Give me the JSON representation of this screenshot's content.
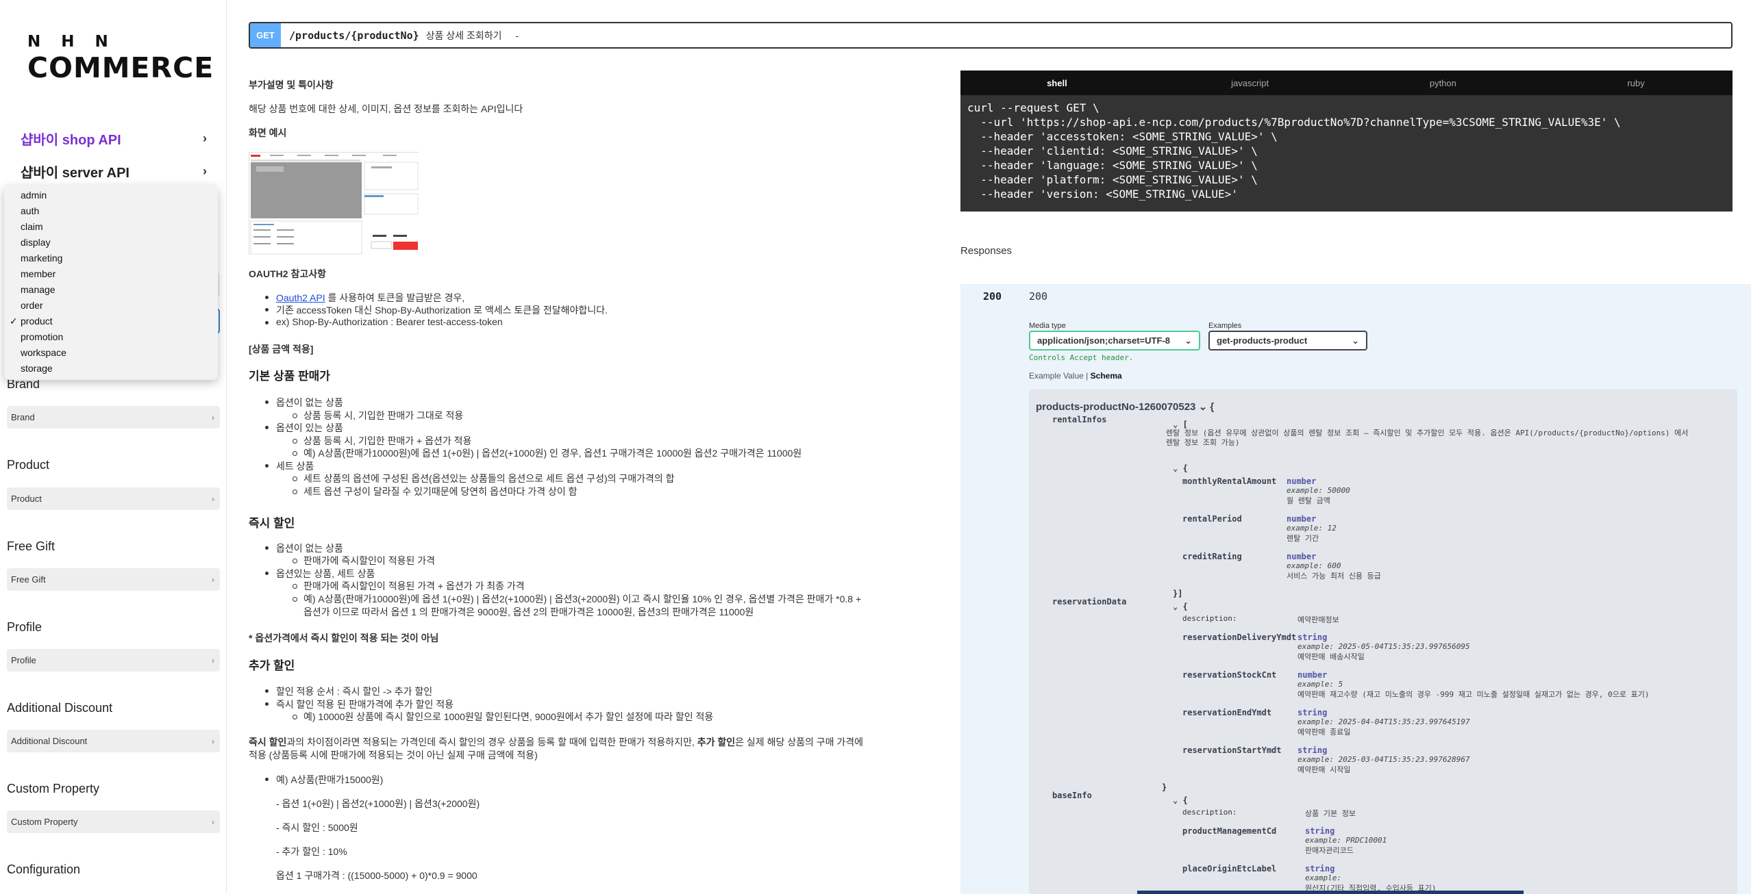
{
  "logo": {
    "top": "N H N",
    "main": "COMMERCE"
  },
  "nav": {
    "shop_api": "샵바이 shop API",
    "server_api": "샵바이 server API"
  },
  "dropdown": {
    "options": [
      "admin",
      "auth",
      "claim",
      "display",
      "marketing",
      "member",
      "manage",
      "order",
      "product",
      "promotion",
      "workspace",
      "storage"
    ],
    "selected": "product",
    "check": "✓"
  },
  "sections": [
    {
      "title": "Brand",
      "select": "Brand"
    },
    {
      "title": "Product",
      "select": "Product"
    },
    {
      "title": "Free Gift",
      "select": "Free Gift"
    },
    {
      "title": "Profile",
      "select": "Profile"
    },
    {
      "title": "Additional Discount",
      "select": "Additional Discount"
    },
    {
      "title": "Custom Property",
      "select": "Custom Property"
    },
    {
      "title": "Configuration",
      "select": ""
    }
  ],
  "operation": {
    "method": "GET",
    "path": "/products/{productNo}",
    "summary": "상품 상세 조회하기",
    "dash": "-"
  },
  "desc": {
    "h_extra": "부가설명 및 특이사항",
    "p_intro": "해당 상품 번호에 대한 상세, 이미지, 옵션 정보를 조회하는 API입니다",
    "h_screen": "화면 예시",
    "h_oauth": "OAUTH2 참고사항",
    "oauth_link": "Oauth2 API",
    "oauth_b1": " 를 사용하여 토큰을 발급받은 경우,",
    "oauth_b2": "기존 accessToken 대신 Shop-By-Authorization 로 액세스 토큰을 전달해야합니다.",
    "oauth_b3": "ex) Shop-By-Authorization : Bearer test-access-token",
    "h_price": "[상품 금액 적용]",
    "h_base": "기본 상품 판매가",
    "base_b1": "옵션이 없는 상품",
    "base_b1s1": "상품 등록 시, 기입한 판매가 그대로 적용",
    "base_b2": "옵션이 있는 상품",
    "base_b2s1": "상품 등록 시, 기입한 판매가 + 옵션가 적용",
    "base_b2s2": "예) A상품(판매가10000원)에 옵션 1(+0원) | 옵션2(+1000원) 인 경우, 옵션1 구매가격은 10000원 옵션2 구매가격은 11000원",
    "base_b3": "세트 상품",
    "base_b3s1": "세트 상품의 옵션에 구성된 옵션(옵션있는 상품들의 옵션으로 세트 옵션 구성)의 구매가격의 합",
    "base_b3s2": "세트 옵션 구성이 달라질 수 있기때문에 당연히 옵션마다 가격 상이 함",
    "h_instant": "즉시 할인",
    "inst_b1": "옵션이 없는 상품",
    "inst_b1s1": "판매가에 즉시할인이 적용된 가격",
    "inst_b2": "옵션있는 상품, 세트 상품",
    "inst_b2s1": "판매가에 즉시할인이 적용된 가격 + 옵션가 가 최종 가격",
    "inst_b2s2a": "예) A상품(판매가10000원)에 옵션 1(+0원) | 옵션2(+1000원) | 옵션3(+2000원) 이고 즉시 할인율 10% 인 경우, 옵션별 가격은 판매가 *0.8 +",
    "inst_b2s2b": "옵션가 이므로 따라서 옵션 1 의 판매가격은 9000원, 옵션 2의 판매가격은 10000원, 옵션3의 판매가격은 11000원",
    "inst_note": "* 옵션가격에서 즉시 할인이 적용 되는 것이 아님",
    "h_extra_disc": "추가 할인",
    "ex_b1": "할인 적용 순서 : 즉시 할인 -> 추가 할인",
    "ex_b2": "즉시 할인 적용 된 판매가격에 추가 할인 적용",
    "ex_b2s1": "예) 10000원 상품에 즉시 할인으로 1000원일 할인된다면, 9000원에서 추가 할인 설정에 따라 할인 적용",
    "diff_bold1": "즉시 할인",
    "diff_mid": "과의 차이점이라면 적용되는 가격인데 즉시 할인의 경우 상품을 등록 할 때에 입력한 판매가 적용하지만, ",
    "diff_bold2": "추가 할인",
    "diff_end": "은 실제 해당 상품의 구매 가격에",
    "diff_line2": "적용 (상품등록 시에 판매가에 적용되는 것이 아닌 실제 구매 금액에 적용)",
    "ex_item": "예) A상품(판매가15000원)",
    "ex_opts": "- 옵션 1(+0원) | 옵션2(+1000원) | 옵션3(+2000원)",
    "ex_inst": "- 즉시 할인 : 5000원",
    "ex_add": "- 추가 할인 : 10%",
    "ex_calc": "옵션 1 구매가격 : ((15000-5000) + 0)*0.9 = 9000"
  },
  "code": {
    "tabs": [
      "shell",
      "javascript",
      "python",
      "ruby"
    ],
    "active": "shell",
    "lines": [
      "curl --request GET \\",
      "  --url 'https://shop-api.e-ncp.com/products/%7BproductNo%7D?channelType=%3CSOME_STRING_VALUE%3E' \\",
      "  --header 'accesstoken: <SOME_STRING_VALUE>' \\",
      "  --header 'clientid: <SOME_STRING_VALUE>' \\",
      "  --header 'language: <SOME_STRING_VALUE>' \\",
      "  --header 'platform: <SOME_STRING_VALUE>' \\",
      "  --header 'version: <SOME_STRING_VALUE>'"
    ]
  },
  "responses": {
    "heading": "Responses",
    "code": "200",
    "description": "200",
    "media_type_label": "Media type",
    "media_type": "application/json;charset=UTF-8",
    "examples_label": "Examples",
    "examples": "get-products-product",
    "controls": "Controls Accept header.",
    "tab_example": "Example Value",
    "tab_sep": "|",
    "tab_schema": "Schema"
  },
  "schema": {
    "model": "products-productNo-1260070523",
    "brace_open": "{",
    "rentalInfos": "rentalInfos",
    "rental_open": "[",
    "rental_desc1": "렌탈 정보 (옵션 유무에 상관없이 상품의 렌탈 정보 조회 – 즉시할인 및 추가할인 모두 적용. 옵션은 API(/products/{productNo}/options) 에서",
    "rental_desc2": "렌탈 정보 조회 가능)",
    "obj_open": "{",
    "monthlyRentalAmount": "monthlyRentalAmount",
    "mra_type": "number",
    "mra_ex": "example: 50000",
    "mra_desc": "월 렌탈 금액",
    "rentalPeriod": "rentalPeriod",
    "rp_type": "number",
    "rp_ex": "example: 12",
    "rp_desc": "렌탈 기간",
    "creditRating": "creditRating",
    "cr_type": "number",
    "cr_ex": "example: 600",
    "cr_desc": "서비스 가능 최저 신용 등급",
    "rental_close": "}]",
    "reservationData": "reservationData",
    "desc_label": "description:",
    "res_desc": "예약판매정보",
    "reservationDeliveryYmdt": "reservationDeliveryYmdt",
    "rdy_type": "string",
    "rdy_ex": "example: 2025-05-04T15:35:23.997656095",
    "rdy_desc": "예약판매 배송시작일",
    "reservationStockCnt": "reservationStockCnt",
    "rsc_type": "number",
    "rsc_ex": "example: 5",
    "rsc_desc": "예약판매 재고수량 (재고 미노출의 경우 -999 재고 미노출 설정일때 실재고가 없는 경우, 0으로 표기)",
    "reservationEndYmdt": "reservationEndYmdt",
    "rey_type": "string",
    "rey_ex": "example: 2025-04-04T15:35:23.997645197",
    "rey_desc": "예약판매 종료일",
    "reservationStartYmdt": "reservationStartYmdt",
    "rsy_type": "string",
    "rsy_ex": "example: 2025-03-04T15:35:23.997628967",
    "rsy_desc": "예약판매 시작일",
    "res_close": "}",
    "baseInfo": "baseInfo",
    "base_desc": "상품 기본 정보",
    "productManagementCd": "productManagementCd",
    "pmc_type": "string",
    "pmc_ex": "example: PRDC10001",
    "pmc_desc": "판매자관리코드",
    "placeOriginEtcLabel": "placeOriginEtcLabel",
    "poe_type": "string",
    "poe_ex": "example:",
    "poe_desc": "원산지(기타 직접입력, 수입사등 표기)"
  },
  "colors": {
    "accent_purple": "#7b2fd2",
    "get_blue": "#61affe",
    "green": "#49cc90"
  }
}
